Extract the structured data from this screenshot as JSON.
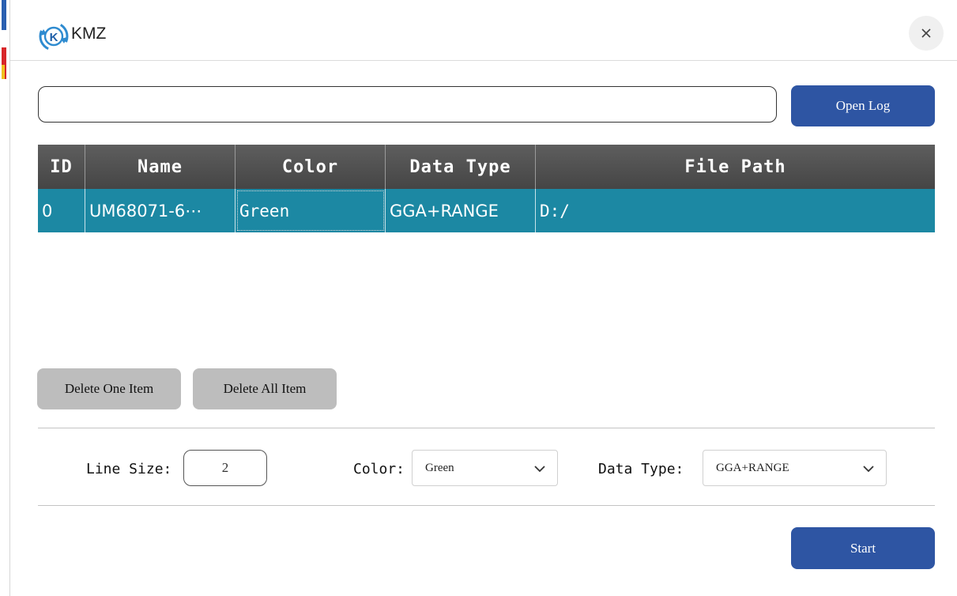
{
  "window": {
    "title": "KMZ",
    "logo_letter": "K"
  },
  "file_path_input": {
    "value": "",
    "placeholder": ""
  },
  "buttons": {
    "open_log": "Open Log",
    "delete_one": "Delete One Item",
    "delete_all": "Delete All Item",
    "start": "Start"
  },
  "table": {
    "headers": [
      "ID",
      "Name",
      "Color",
      "Data Type",
      "File Path"
    ],
    "rows": [
      {
        "id": "0",
        "name": "UM68071-6⋯",
        "color": "Green",
        "data_type": "GGA+RANGE",
        "file_path": "D:/"
      }
    ]
  },
  "settings": {
    "line_size_label": "Line Size:",
    "line_size_value": "2",
    "color_label": "Color:",
    "color_value": "Green",
    "data_type_label": "Data Type:",
    "data_type_value": "GGA+RANGE"
  },
  "colors": {
    "primary_button": "#2e55a3",
    "table_header": "#4f4f4f",
    "selected_row": "#1c88a3",
    "gray_button": "#bdbdbd"
  },
  "icons": {
    "logo": "kmz-logo-icon",
    "close": "close-icon",
    "dropdown": "chevron-down-icon"
  }
}
